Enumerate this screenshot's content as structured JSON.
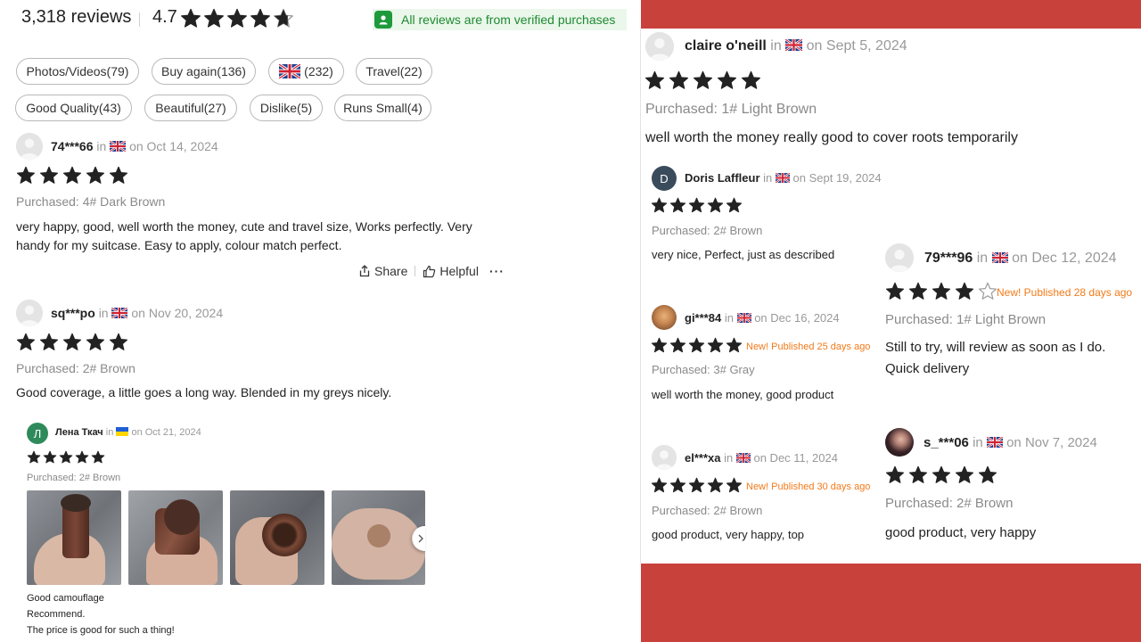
{
  "header": {
    "review_count": "3,318 reviews",
    "rating": "4.7",
    "rating_stars": 4.7,
    "verified_text": "All reviews are from verified purchases"
  },
  "filters": [
    {
      "label": "Photos/Videos(79)"
    },
    {
      "label": "Buy again(136)"
    },
    {
      "label": "(232)",
      "flag": "uk-flag"
    },
    {
      "label": "Travel(22)"
    },
    {
      "label": "Good Quality(43)"
    },
    {
      "label": "Beautiful(27)"
    },
    {
      "label": "Dislike(5)"
    },
    {
      "label": "Runs Small(4)"
    }
  ],
  "common": {
    "in": "in",
    "share": "Share",
    "helpful": "Helpful",
    "more": "···"
  },
  "reviews": {
    "r1": {
      "user": "74***66",
      "date": "on Oct 14, 2024",
      "stars": 5,
      "purchased": "Purchased: 4# Dark Brown",
      "text": "very happy, good, well worth the money, cute and travel size, Works perfectly. Very handy for my suitcase. Easy to apply, colour match perfect."
    },
    "r2": {
      "user": "sq***po",
      "date": "on Nov 20, 2024",
      "stars": 5,
      "purchased": "Purchased: 2# Brown",
      "text": "Good coverage, a little goes a long way. Blended in my greys nicely."
    },
    "r3": {
      "avatar_letter": "Л",
      "user": "Лена Ткач",
      "date": "on Oct 21, 2024",
      "stars": 5,
      "purchased": "Purchased: 2# Brown",
      "text_lines": [
        "Good camouflage",
        "Recommend.",
        "The price is good for such a thing!"
      ]
    },
    "r4": {
      "user": "claire o'neill",
      "date": "on Sept 5, 2024",
      "stars": 5,
      "purchased": "Purchased: 1# Light Brown",
      "text": "well worth the money really good to cover roots temporarily"
    },
    "r5": {
      "avatar_letter": "D",
      "user": "Doris Laffleur",
      "date": "on Sept 19, 2024",
      "stars": 5,
      "purchased": "Purchased: 2# Brown",
      "text": "very nice, Perfect, just as described"
    },
    "r6": {
      "user": "gi***84",
      "date": "on Dec 16, 2024",
      "stars": 5,
      "published": "New! Published 25 days ago",
      "purchased": "Purchased: 3# Gray",
      "text": "well worth the money, good product"
    },
    "r7": {
      "user": "el***xa",
      "date": "on Dec 11, 2024",
      "stars": 5,
      "published": "New! Published 30 days ago",
      "purchased": "Purchased: 2# Brown",
      "text": "good product, very happy, top"
    },
    "r8": {
      "user": "79***96",
      "date": "on Dec 12, 2024",
      "stars": 4,
      "published": "New! Published 28 days ago",
      "purchased": "Purchased: 1# Light Brown",
      "text_lines": [
        "Still to try, will review as soon as I do.",
        "Quick delivery"
      ]
    },
    "r9": {
      "user": "s_***06",
      "date": "on Nov 7, 2024",
      "stars": 5,
      "purchased": "Purchased: 2# Brown",
      "text": "good product, very happy"
    }
  },
  "colors": {
    "accent_red": "#c8413b",
    "verified_green": "#1e9a3c",
    "new_orange": "#f27a1a",
    "star": "#222222"
  }
}
